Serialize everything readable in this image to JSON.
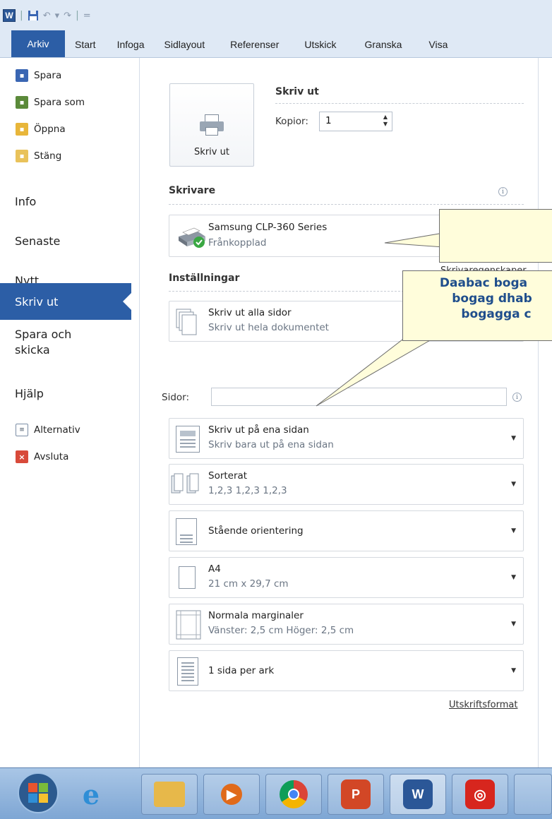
{
  "qat": {
    "word_logo": "W",
    "undo": "↶",
    "redo": "↷",
    "more": "="
  },
  "tabs": [
    {
      "label": "Arkiv"
    },
    {
      "label": "Start"
    },
    {
      "label": "Infoga"
    },
    {
      "label": "Sidlayout"
    },
    {
      "label": "Referenser"
    },
    {
      "label": "Utskick"
    },
    {
      "label": "Granska"
    },
    {
      "label": "Visa"
    }
  ],
  "nav": {
    "spara": "Spara",
    "spara_som": "Spara som",
    "oppna": "Öppna",
    "stang": "Stäng",
    "info": "Info",
    "senaste": "Senaste",
    "nytt": "Nytt",
    "skriv_ut": "Skriv ut",
    "spara_och_skicka_1": "Spara och",
    "spara_och_skicka_2": "skicka",
    "hjalp": "Hjälp",
    "alternativ": "Alternativ",
    "avsluta": "Avsluta"
  },
  "print": {
    "button_label": "Skriv ut",
    "title": "Skriv ut",
    "copies_label": "Kopior:",
    "copies_value": "1"
  },
  "printer": {
    "section": "Skrivare",
    "name": "Samsung CLP-360 Series",
    "status": "Frånkopplad",
    "properties_link": "Skrivaregenskaper"
  },
  "settings": {
    "section": "Inställningar",
    "pages_label": "Sidor:",
    "pages_value": "",
    "items": [
      {
        "line1": "Skriv ut alla sidor",
        "line2": "Skriv ut hela dokumentet"
      },
      {
        "line1": "Skriv ut på ena sidan",
        "line2": "Skriv bara ut på ena sidan"
      },
      {
        "line1": "Sorterat",
        "line2": "1,2,3   1,2,3   1,2,3"
      },
      {
        "line1": "Stående orientering",
        "line2": ""
      },
      {
        "line1": "A4",
        "line2": "21 cm x 29,7 cm"
      },
      {
        "line1": "Normala marginaler",
        "line2": "Vänster: 2,5 cm   Höger: 2,5 cm"
      },
      {
        "line1": "1 sida per ark",
        "line2": ""
      }
    ],
    "page_setup_link": "Utskriftsformat"
  },
  "callouts": {
    "second_l1": "Daabac boga",
    "second_l2": "bogag dhab",
    "second_l3": "bogagga c"
  },
  "colors": {
    "accent": "#2c5ea6",
    "ribbon_bg": "#dfe9f5",
    "callout_bg": "#fffddb",
    "callout_text": "#1f4e8c"
  }
}
